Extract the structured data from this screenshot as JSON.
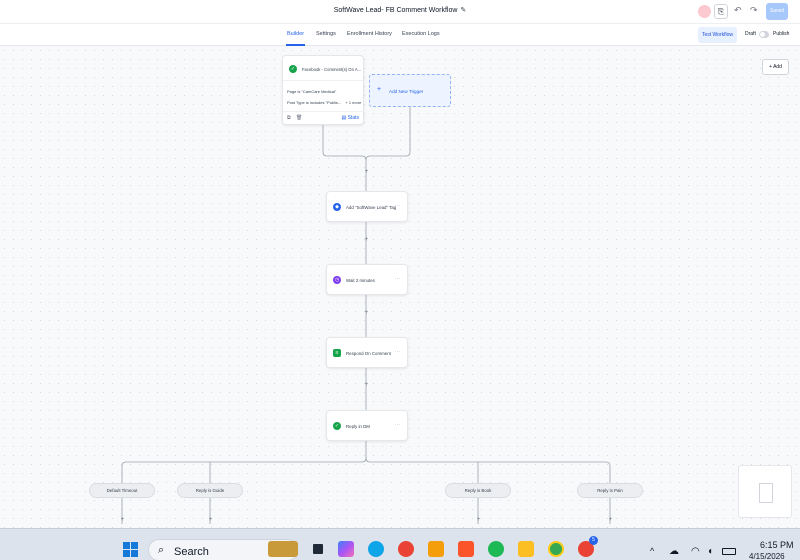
{
  "header": {
    "title": "SoftWave Lead- FB Comment Workflow",
    "avatar_initials": "",
    "save_label": "Saved"
  },
  "tabs": [
    {
      "label": "Builder",
      "active": true
    },
    {
      "label": "Settings",
      "active": false
    },
    {
      "label": "Enrollment History",
      "active": false
    },
    {
      "label": "Execution Logs",
      "active": false
    }
  ],
  "subbar": {
    "test_label": "Test Workflow",
    "draft_label": "Draft",
    "publish_label": "Publish",
    "published": false
  },
  "canvas": {
    "add_label": "+ Add"
  },
  "trigger": {
    "title": "Facebook - Comment(s) On A...",
    "condition1": "Page is \"CamCare Medical\"",
    "condition2": "Post Type is includes \"Publis...",
    "more": "+ 1 more",
    "stats_label": "Stats",
    "icon": "facebook-check-icon"
  },
  "add_trigger": {
    "label": "Add New Trigger"
  },
  "actions": [
    {
      "label": "Add \"SoftWave Lead\" Tag",
      "icon": "tag-icon",
      "color": "#2563eb"
    },
    {
      "label": "Wait 2 minutes",
      "icon": "clock-icon",
      "color": "#7c3aed"
    },
    {
      "label": "Respond On Comment",
      "icon": "comment-icon",
      "color": "#16a34a"
    },
    {
      "label": "Reply in DM",
      "icon": "message-check-icon",
      "color": "#16a34a"
    }
  ],
  "branches": [
    {
      "label": "Default Timeout"
    },
    {
      "label": "Reply is Guide"
    },
    {
      "label": "Reply is Book"
    },
    {
      "label": "Reply is Pain"
    }
  ],
  "taskbar": {
    "search_label": "Search",
    "time": "6:15 PM",
    "date": "4/15/2026",
    "chrome_badge": "5"
  }
}
